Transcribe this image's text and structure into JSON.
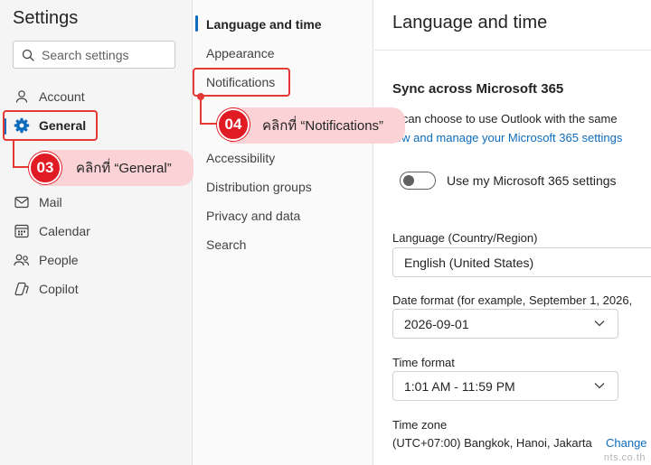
{
  "app": {
    "title": "Settings"
  },
  "search": {
    "placeholder": "Search settings"
  },
  "nav": {
    "items": [
      {
        "label": "Account",
        "icon": "person-icon"
      },
      {
        "label": "General",
        "icon": "gear-icon",
        "active": true
      },
      {
        "label": "Mail",
        "icon": "mail-icon"
      },
      {
        "label": "Calendar",
        "icon": "calendar-icon"
      },
      {
        "label": "People",
        "icon": "people-icon"
      },
      {
        "label": "Copilot",
        "icon": "copilot-icon"
      }
    ]
  },
  "subnav": {
    "items": [
      {
        "label": "Language and time",
        "active": true
      },
      {
        "label": "Appearance"
      },
      {
        "label": "Notifications"
      },
      {
        "label": "Accessibility"
      },
      {
        "label": "Distribution groups"
      },
      {
        "label": "Privacy and data"
      },
      {
        "label": "Search"
      }
    ]
  },
  "main": {
    "title": "Language and time",
    "sync_title": "Sync across Microsoft 365",
    "sync_desc": "u can choose to use Outlook with the same",
    "sync_link": "iew and manage your Microsoft 365 settings",
    "toggle_label": "Use my Microsoft 365 settings",
    "toggle_on": false,
    "language_label": "Language (Country/Region)",
    "language_value": "English (United States)",
    "date_label": "Date format (for example, September 1, 2026,",
    "date_value": "2026-09-01",
    "time_label": "Time format",
    "time_value": "1:01 AM - 11:59 PM",
    "timezone_label": "Time zone",
    "timezone_value": "(UTC+07:00) Bangkok, Hanoi, Jakarta",
    "timezone_change": "Change"
  },
  "callouts": [
    {
      "step": "03",
      "text": "คลิกที่ “General”"
    },
    {
      "step": "04",
      "text": "คลิกที่ “Notifications”"
    }
  ],
  "watermark": "nts.co.th",
  "colors": {
    "accent": "#0f6cbd",
    "highlight": "#e53935",
    "callout_bg": "#fbd3d6"
  }
}
